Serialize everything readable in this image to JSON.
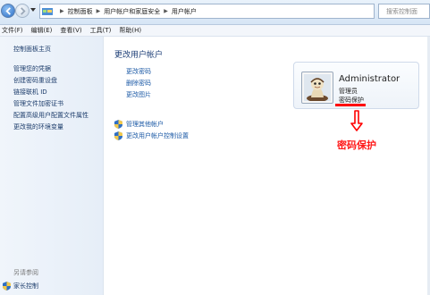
{
  "address": {
    "breadcrumbs": [
      "控制面板",
      "用户帐户和家庭安全",
      "用户帐户"
    ],
    "search_placeholder": "搜索控制面"
  },
  "menu": [
    "文件(F)",
    "编辑(E)",
    "查看(V)",
    "工具(T)",
    "帮助(H)"
  ],
  "sidebar": {
    "home": "控制面板主页",
    "links": [
      "管理您的凭据",
      "创建密码重设盘",
      "链接联机 ID",
      "管理文件加密证书",
      "配置高级用户配置文件属性",
      "更改我的环境变量"
    ],
    "see_also": "另请参阅",
    "parental": "家长控制"
  },
  "main": {
    "title": "更改用户帐户",
    "links": [
      "更改密码",
      "删除密码",
      "更改图片"
    ],
    "shield_links": [
      "管理其他帐户",
      "更改用户帐户控制设置"
    ]
  },
  "account": {
    "name": "Administrator",
    "role": "管理员",
    "status": "密码保护"
  },
  "annotation": {
    "text": "密码保护",
    "color": "#ff1a1a"
  }
}
